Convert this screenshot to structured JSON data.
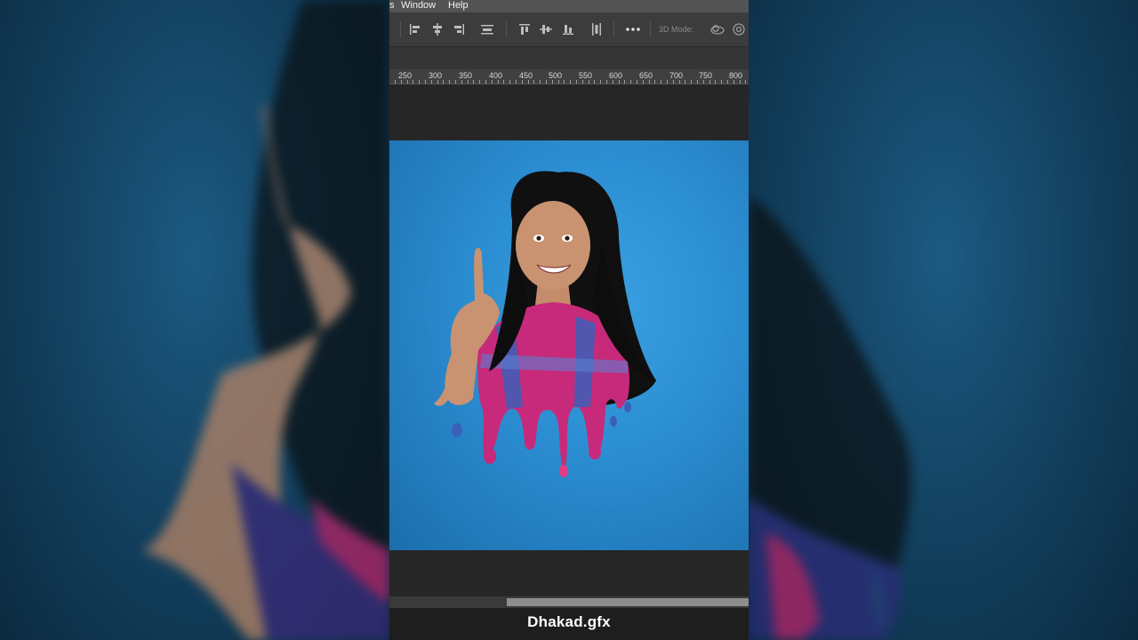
{
  "menu": {
    "partial_left": "s",
    "window": "Window",
    "help": "Help"
  },
  "options_bar": {
    "mode_label": "3D Mode:",
    "icons": [
      "align-left-edges-icon",
      "align-horizontal-centers-icon",
      "align-right-edges-icon",
      "distribute-vertical-icon",
      "align-top-edges-icon",
      "align-vertical-centers-icon",
      "align-bottom-edges-icon",
      "distribute-horizontal-icon",
      "more-options-icon",
      "orbit-3d-icon",
      "roll-3d-icon"
    ]
  },
  "ruler": {
    "labels": [
      "250",
      "300",
      "350",
      "400",
      "450",
      "500",
      "550",
      "600",
      "650",
      "700",
      "750",
      "800"
    ]
  },
  "canvas": {
    "background_color": "#2c8fd3",
    "content": "photo-of-girl-pointing-up-with-dripping-paint-effect"
  },
  "watermark": {
    "text": "Dhakad.gfx"
  },
  "colors": {
    "app_background": "#282828",
    "menubar": "#535353",
    "options_bar": "#3c3c3c",
    "page_background": "#0f3550"
  }
}
